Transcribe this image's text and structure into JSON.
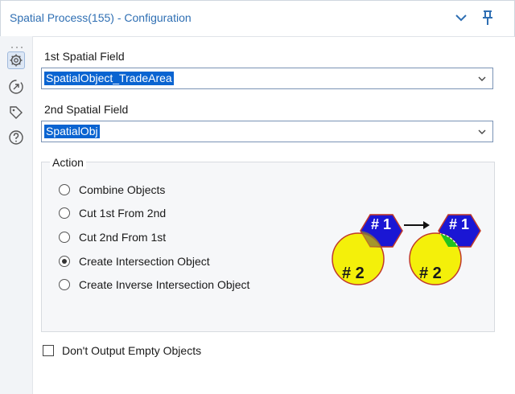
{
  "window": {
    "title": "Spatial Process(155) - Configuration",
    "accent_color": "#2f6fb3"
  },
  "sidebar": {
    "icons": [
      {
        "name": "gear-icon",
        "active": true
      },
      {
        "name": "arrow-circle-icon",
        "active": false
      },
      {
        "name": "tag-icon",
        "active": false
      },
      {
        "name": "help-icon",
        "active": false
      }
    ]
  },
  "fields": {
    "first": {
      "label": "1st Spatial Field",
      "value": "SpatialObject_TradeArea"
    },
    "second": {
      "label": "2nd Spatial Field",
      "value": "SpatialObj"
    }
  },
  "action": {
    "label": "Action",
    "options": [
      {
        "label": "Combine Objects",
        "checked": false
      },
      {
        "label": "Cut 1st From 2nd",
        "checked": false
      },
      {
        "label": "Cut 2nd From 1st",
        "checked": false
      },
      {
        "label": "Create Intersection Object",
        "checked": true
      },
      {
        "label": "Create Inverse Intersection Object",
        "checked": false
      }
    ],
    "illustration": {
      "hexagon_label": "# 1",
      "circle_label": "# 2",
      "hexagon_color": "#1a16d4",
      "circle_color": "#f4f00a",
      "outline_color": "#c0392b",
      "intersection_color": "#22c21e"
    }
  },
  "options": {
    "dont_output_empty": {
      "label": "Don't Output Empty Objects",
      "checked": false
    }
  }
}
